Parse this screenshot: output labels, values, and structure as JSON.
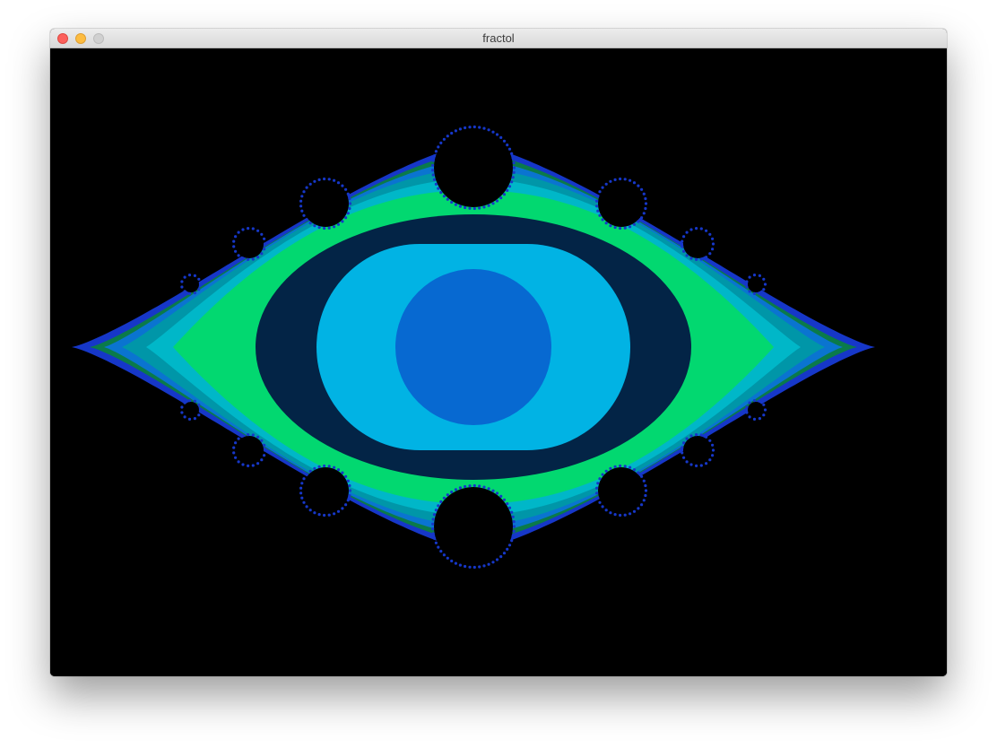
{
  "window": {
    "title": "fractol",
    "controls": {
      "close_icon": "close-icon",
      "minimize_icon": "minimize-icon",
      "zoom_icon": "zoom-icon"
    }
  },
  "canvas": {
    "background": "#000000",
    "palette": {
      "outer_band_blue": "#1637c8",
      "dark_green": "#0a7a4a",
      "blue": "#0a74d0",
      "teal": "#0096a8",
      "cyan": "#00b7c8",
      "green": "#02d870",
      "navy": "#032446",
      "light_blue": "#01b3e4",
      "center_blue": "#0769d1"
    }
  }
}
